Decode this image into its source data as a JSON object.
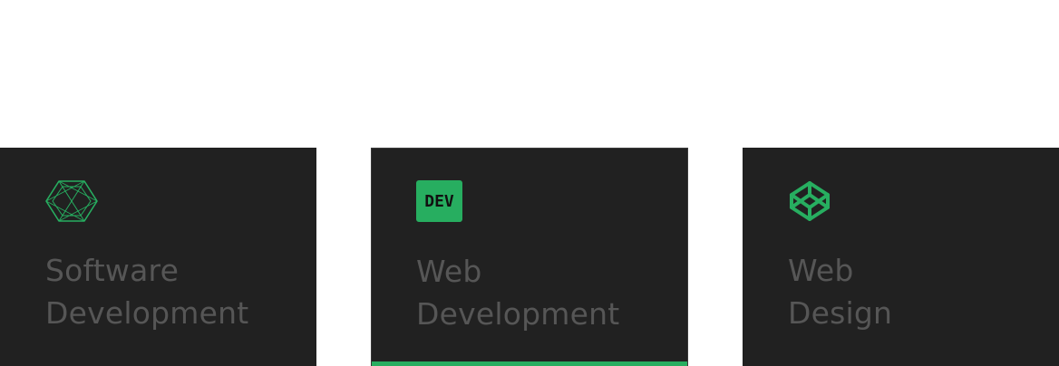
{
  "accent_color": "#27ae60",
  "card_background": "#212121",
  "label_color": "#565656",
  "cards": [
    {
      "icon": "hexagon-lattice-icon",
      "title_line1": "Software",
      "title_line2": "Development",
      "active": false
    },
    {
      "icon": "dev-logo-icon",
      "badge_text": "DEV",
      "title_line1": "Web",
      "title_line2": "Development",
      "active": true
    },
    {
      "icon": "codepen-cube-icon",
      "title_line1": "Web",
      "title_line2": "Design",
      "active": false
    }
  ]
}
